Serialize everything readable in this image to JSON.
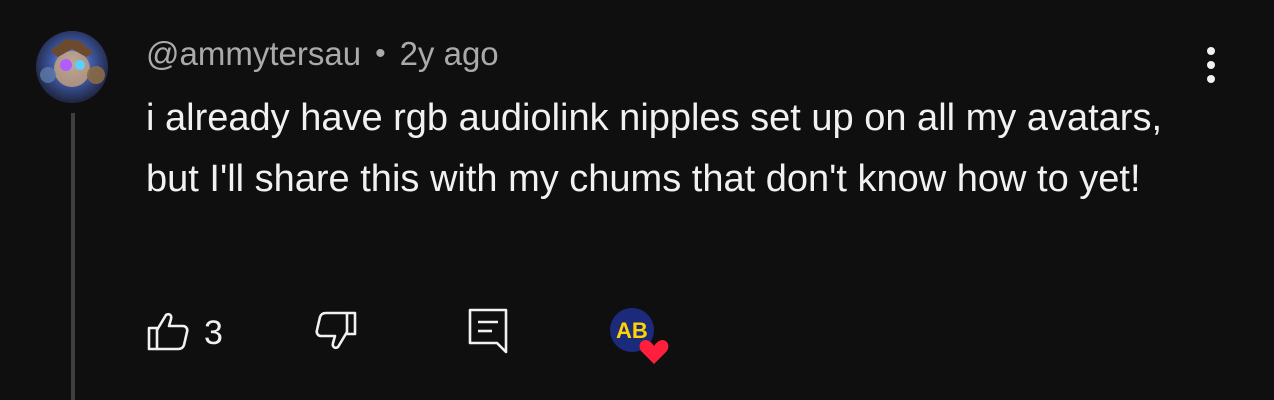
{
  "comment": {
    "author": "@ammytersau",
    "separator": "•",
    "time": "2y ago",
    "text": "i already have rgb audiolink nipples set up on all my avatars, but I'll share this with my chums that don't know how to yet!",
    "likes": "3"
  },
  "icons": {
    "avatar": "user-avatar",
    "more": "more-vertical-icon",
    "like": "thumbs-up-icon",
    "dislike": "thumbs-down-icon",
    "reply": "reply-comment-icon",
    "creator_heart": "creator-heart-badge"
  },
  "creator_heart_badge_text": "AB",
  "colors": {
    "background": "#0f0f0f",
    "text": "#f1f1f1",
    "meta": "#aaaaaa",
    "heart": "#ff1f3d",
    "thread_line": "#3f3f3f"
  }
}
